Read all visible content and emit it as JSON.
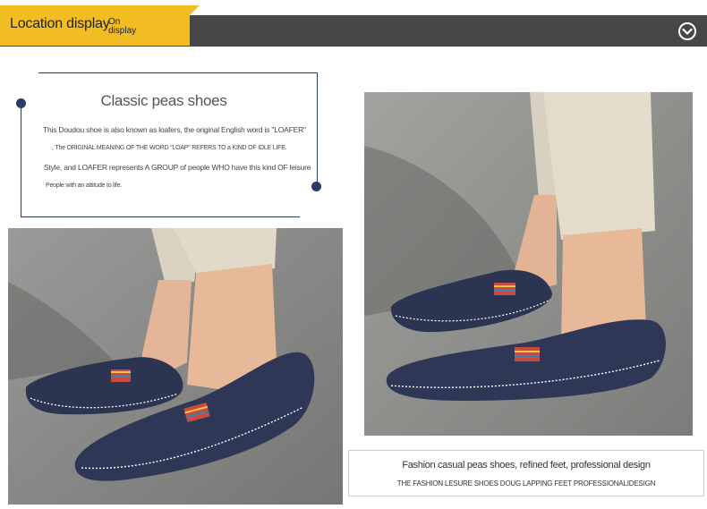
{
  "header": {
    "title": "Location display",
    "sub_line1": "On",
    "sub_line2": "display",
    "icon": "chevron-down-circle-icon",
    "accent_color": "#f2bd23",
    "bar_color": "#474747"
  },
  "intro": {
    "title": "Classic peas shoes",
    "lines": [
      "This Doudou shoe is also known as loafers, the original English word is \"LOAFER\"",
      ", The ORIGINAL MEANING OF THE WORD \"LOAP\" REFERS TO a KIND OF IDLE LIFE.",
      "Style, and LOAFER represents A GROUP of people WHO have this kind OF leisure",
      "People with an attitude to life."
    ]
  },
  "caption": {
    "line1": "Fashion casual peas shoes, refined feet, professional design",
    "line2": "THE FASHION LESURE SHOES DOUG LAPPING FEET PROFESSIONALIDESIGN"
  },
  "colors": {
    "frame": "#2c3b66",
    "shoe": "#2d3550",
    "pants": "#d8d0c0",
    "skin": "#e3b394",
    "ground": "#8c8c8c"
  }
}
